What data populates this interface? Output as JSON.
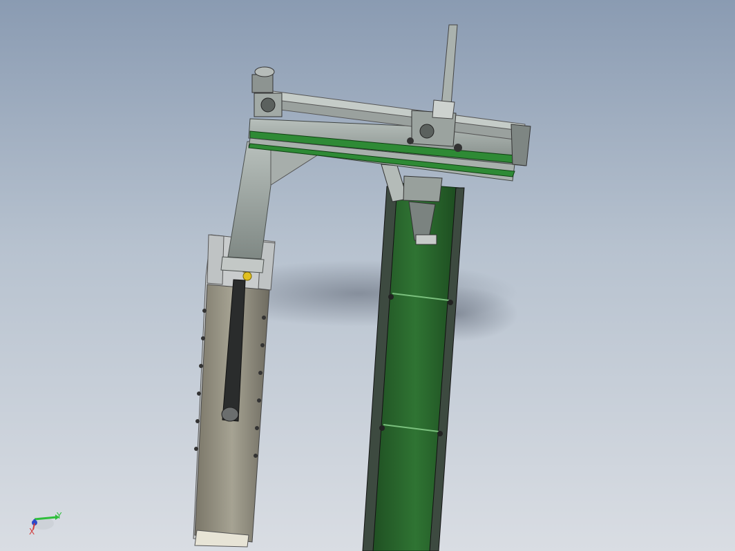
{
  "viewport": {
    "background_top": "#8a9bb2",
    "background_bottom": "#d9dde3"
  },
  "model": {
    "frame_color": "#9ea8a4",
    "conveyor_color": "#2c6b2f",
    "conveyor_light": "#3a8a3e",
    "belt_color": "#8d8b7e",
    "sensor_color": "#e0c020"
  },
  "triad": {
    "y_label": "Y",
    "x_label": "X",
    "y_color": "#2fbf3c",
    "z_color": "#2d49c8",
    "x_color": "#d23a3a"
  }
}
